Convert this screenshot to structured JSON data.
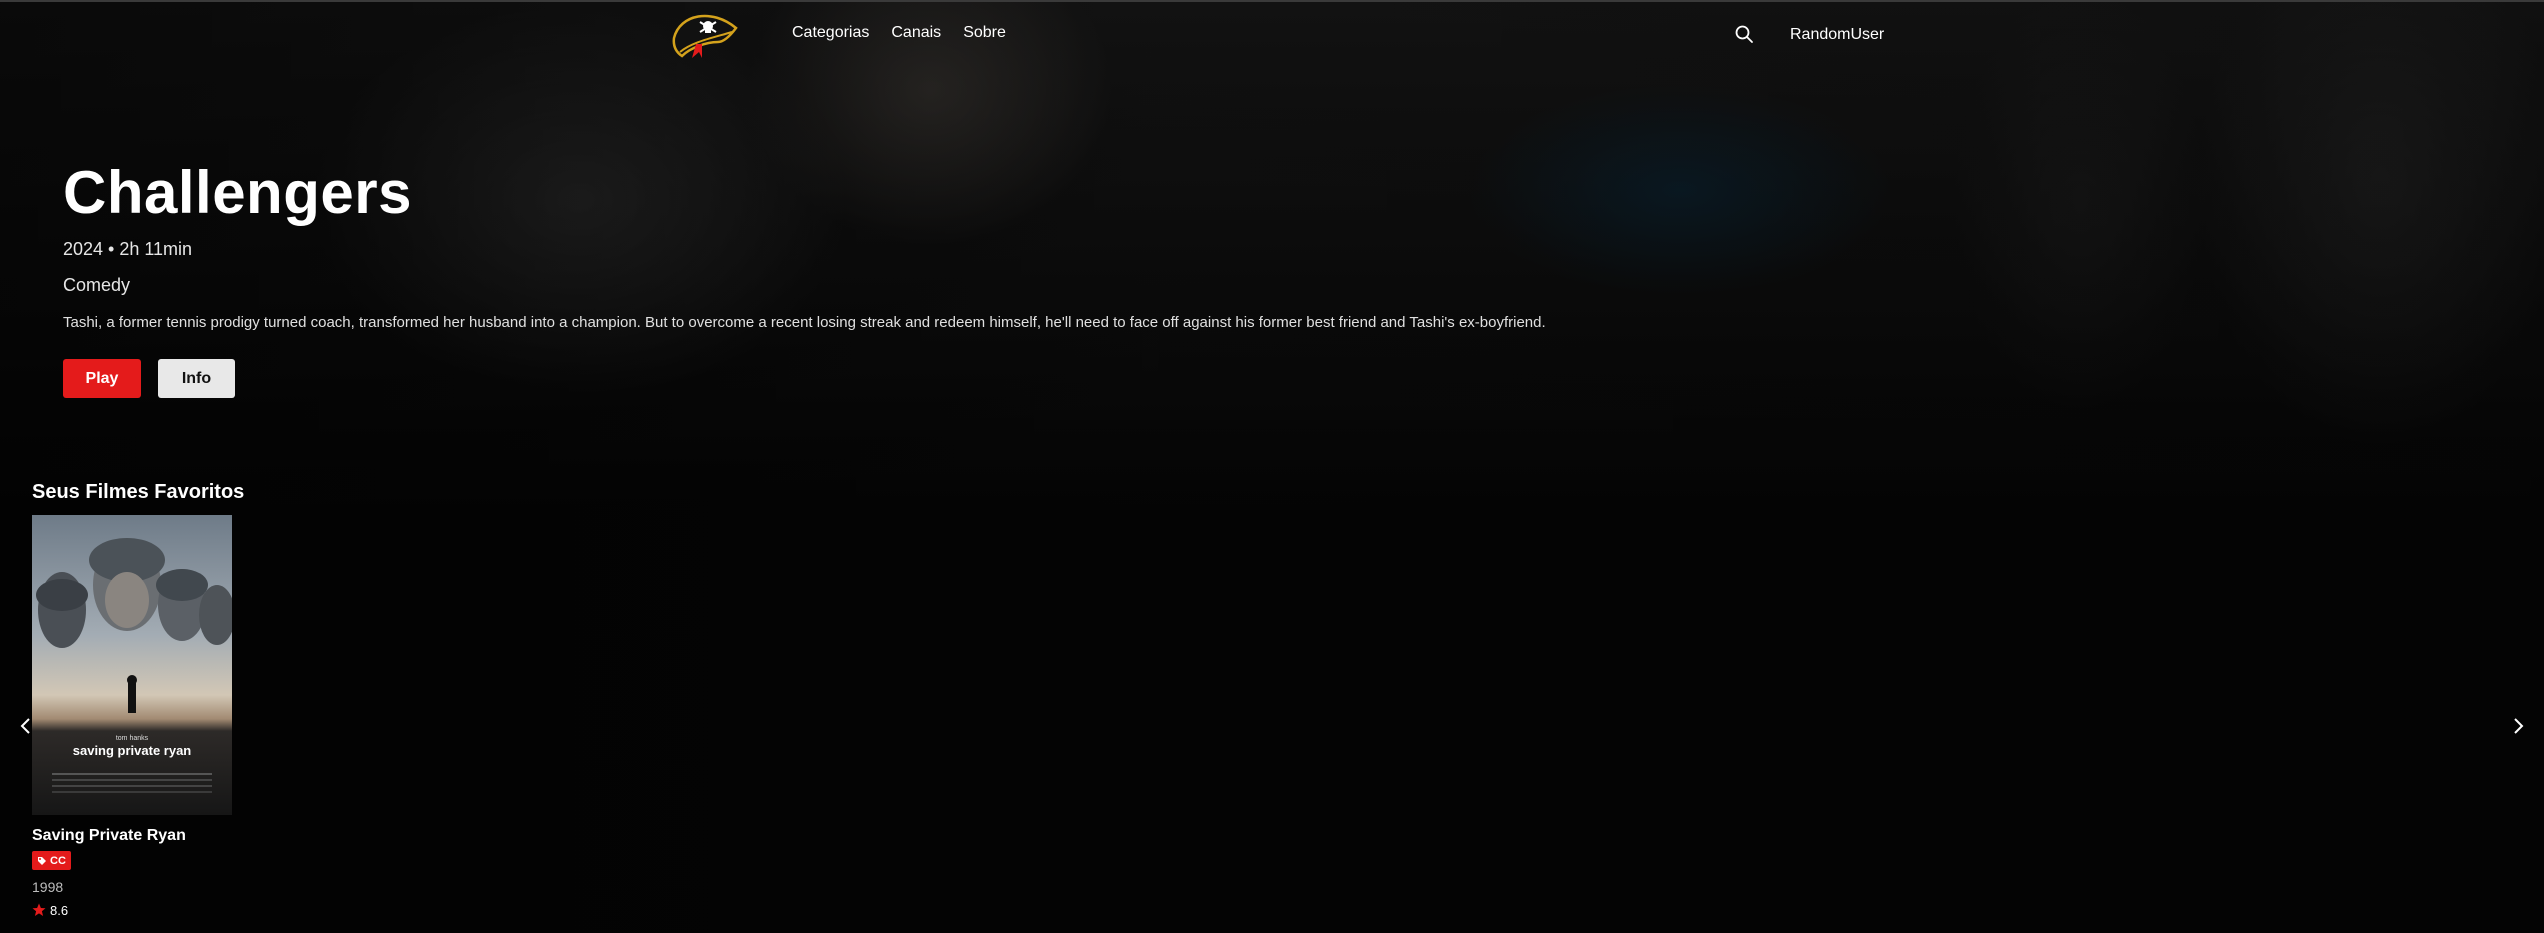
{
  "nav": {
    "links": [
      "Categorias",
      "Canais",
      "Sobre"
    ],
    "user": "RandomUser",
    "logo_icon": "pirate-hat-logo",
    "search_icon": "search-icon"
  },
  "hero": {
    "title": "Challengers",
    "meta": "2024 • 2h 11min",
    "genre": "Comedy",
    "description": "Tashi, a former tennis prodigy turned coach, transformed her husband into a champion. But to overcome a recent losing streak and redeem himself, he'll need to face off against his former best friend and Tashi's ex-boyfriend.",
    "play_label": "Play",
    "info_label": "Info"
  },
  "favorites": {
    "title": "Seus Filmes Favoritos",
    "items": [
      {
        "title": "Saving Private Ryan",
        "badge": "CC",
        "year": "1998",
        "rating": "8.6",
        "poster_text": {
          "actor": "tom hanks",
          "title": "saving private ryan"
        }
      }
    ]
  },
  "colors": {
    "accent": "#e41b1b",
    "info_button": "#e8e8e8",
    "background": "#050505"
  }
}
